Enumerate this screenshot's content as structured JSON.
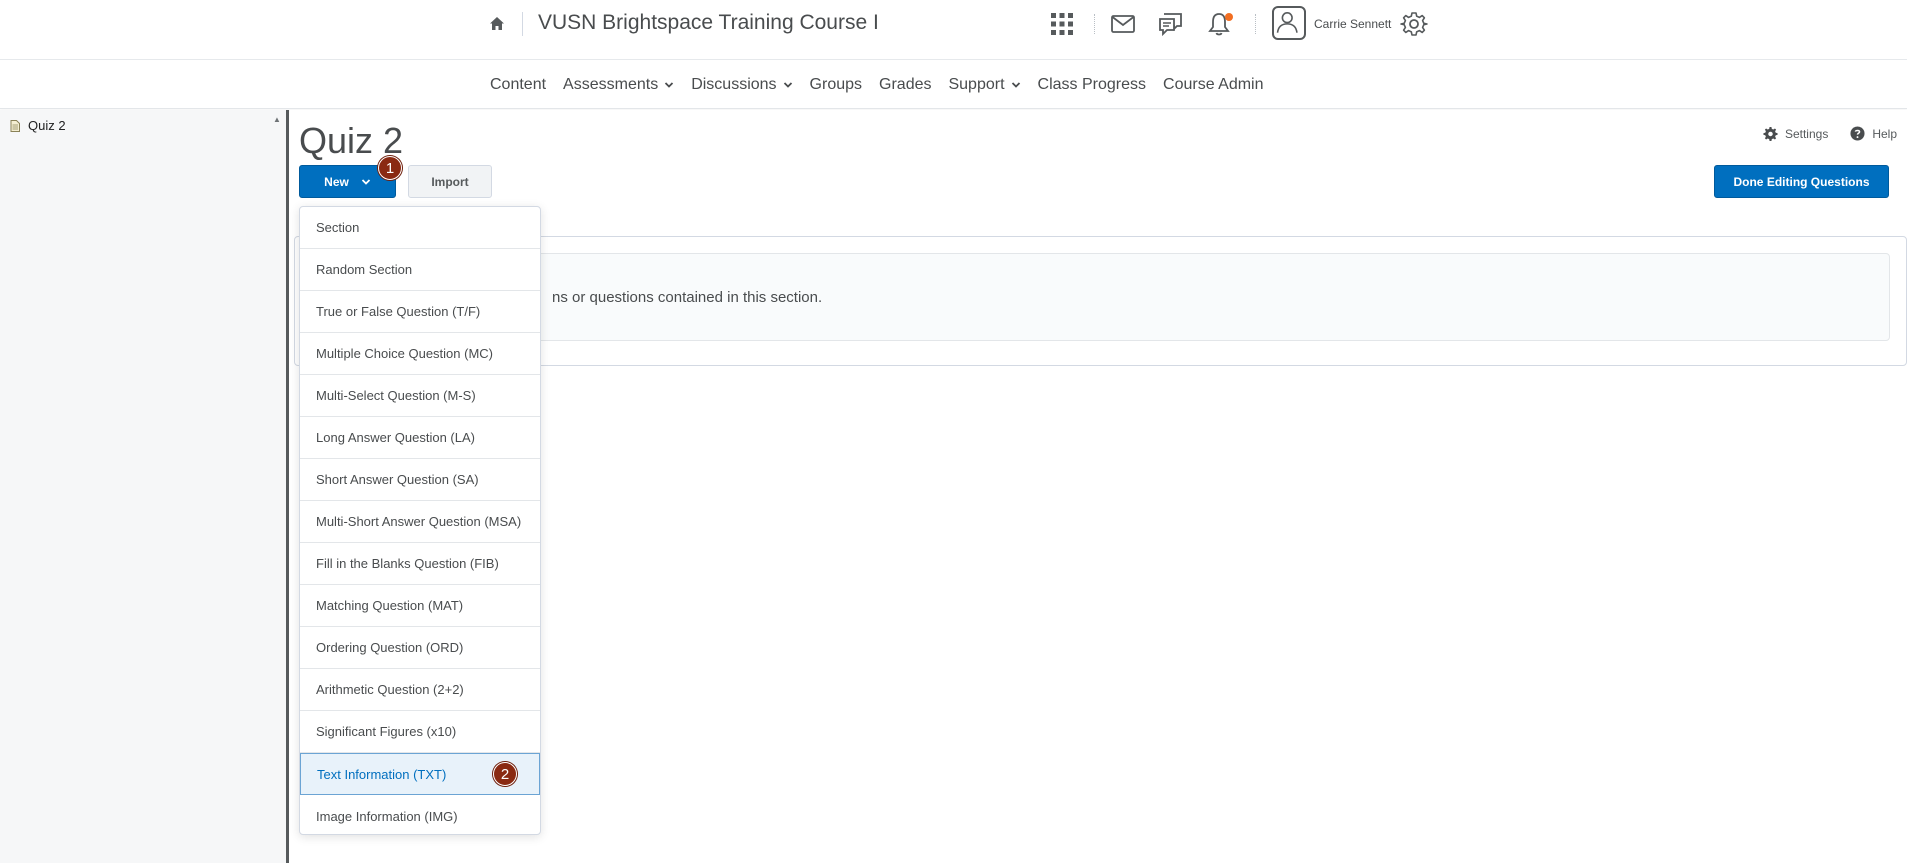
{
  "header": {
    "course_title": "VUSN Brightspace Training Course I",
    "user_name": "Carrie Sennett",
    "icons": [
      "home-icon",
      "waffle-grid-icon",
      "mail-icon",
      "chat-bubbles-icon",
      "bell-icon",
      "avatar-icon",
      "gear-icon"
    ],
    "notification_color": "#f26e21"
  },
  "nav": {
    "items": [
      {
        "label": "Content"
      },
      {
        "label": "Assessments",
        "has_menu": true
      },
      {
        "label": "Discussions",
        "has_menu": true
      },
      {
        "label": "Groups"
      },
      {
        "label": "Grades"
      },
      {
        "label": "Support",
        "has_menu": true
      },
      {
        "label": "Class Progress"
      },
      {
        "label": "Course Admin"
      }
    ]
  },
  "tree": {
    "items": [
      {
        "label": "Quiz 2"
      }
    ]
  },
  "main": {
    "title": "Quiz 2",
    "settings_label": "Settings",
    "help_label": "Help",
    "new_label": "New",
    "import_label": "Import",
    "done_label": "Done Editing Questions",
    "section_message": "ns or questions contained in this section.",
    "accent_color": "#006fbf"
  },
  "steps": {
    "step1": "1",
    "step2": "2",
    "badge_color": "#8a2a12"
  },
  "dropdown": {
    "items": [
      "Section",
      "Random Section",
      "True or False Question (T/F)",
      "Multiple Choice Question (MC)",
      "Multi-Select Question (M-S)",
      "Long Answer Question (LA)",
      "Short Answer Question (SA)",
      "Multi-Short Answer Question (MSA)",
      "Fill in the Blanks Question (FIB)",
      "Matching Question (MAT)",
      "Ordering Question (ORD)",
      "Arithmetic Question (2+2)",
      "Significant Figures (x10)",
      "Text Information (TXT)",
      "Image Information (IMG)"
    ],
    "highlighted": "Text Information (TXT)"
  }
}
